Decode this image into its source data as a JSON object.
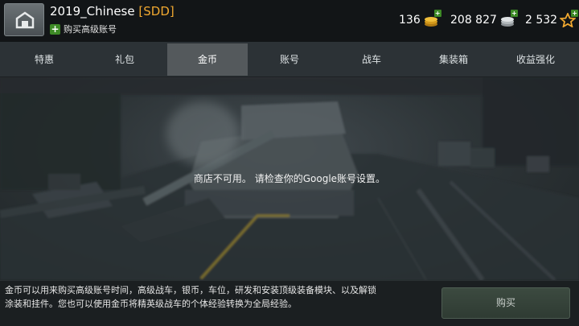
{
  "header": {
    "player_name": "2019_Chinese",
    "clan_tag": "[SDD]",
    "premium_link": "购买高级账号",
    "currencies": {
      "gold": {
        "amount": "136",
        "icon": "gold-coins-icon"
      },
      "silver": {
        "amount": "208 827",
        "icon": "silver-credits-icon"
      },
      "xp": {
        "amount": "2 532",
        "icon": "free-xp-star-icon"
      }
    }
  },
  "tabs": [
    {
      "label": "特惠",
      "active": false
    },
    {
      "label": "礼包",
      "active": false
    },
    {
      "label": "金币",
      "active": true
    },
    {
      "label": "账号",
      "active": false
    },
    {
      "label": "战车",
      "active": false
    },
    {
      "label": "集装箱",
      "active": false
    },
    {
      "label": "收益强化",
      "active": false
    }
  ],
  "main": {
    "message": "商店不可用。 请检查你的Google账号设置。"
  },
  "footer": {
    "description": "金币可以用来购买高级账号时间，高级战车，银币，车位，研发和安装顶级装备模块、以及解锁涂装和挂件。您也可以使用金币将精英级战车的个体经验转换为全局经验。",
    "buy_label": "购买"
  },
  "colors": {
    "clan_tag": "#f0a830",
    "plus_green": "#3d8a26",
    "active_tab": "#54595c",
    "buy_button": "#34423a"
  }
}
